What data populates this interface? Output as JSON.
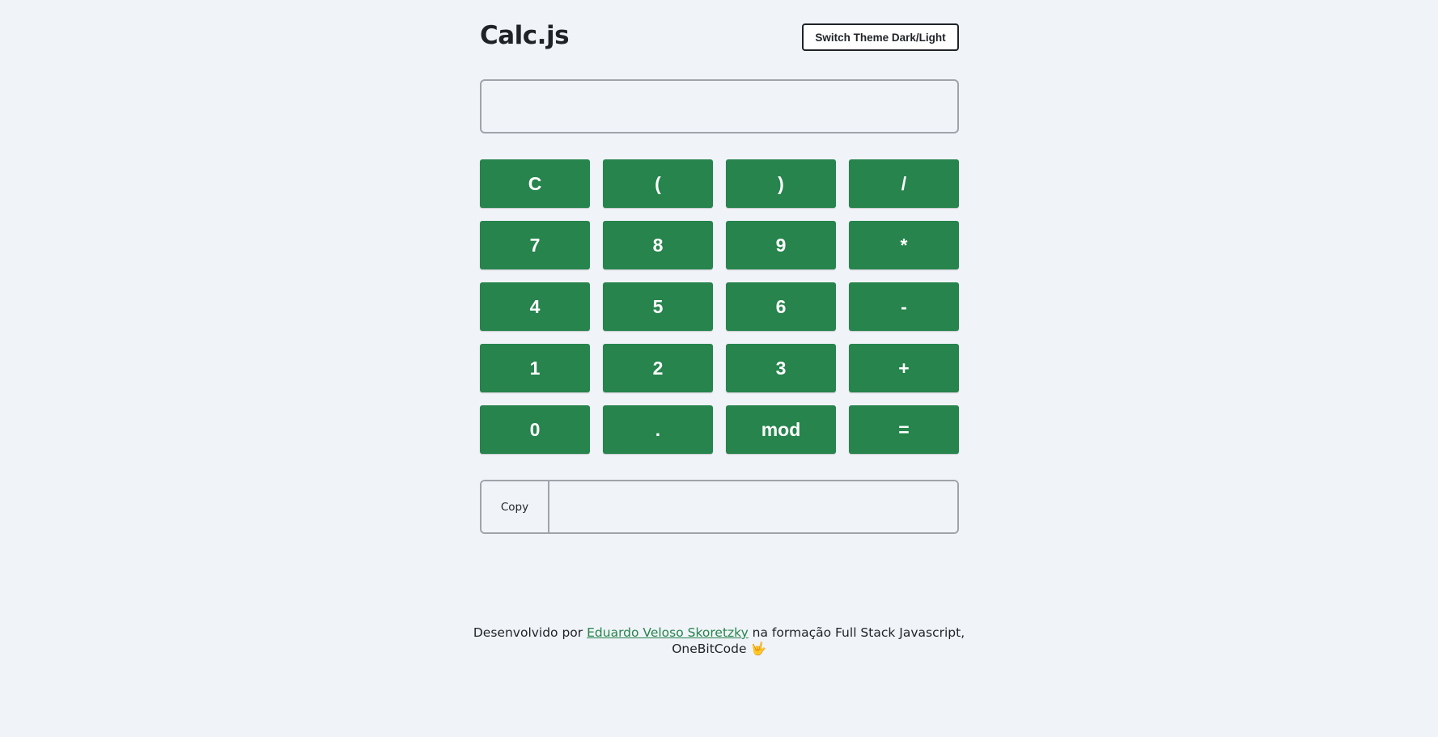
{
  "header": {
    "title": "Calc.js",
    "theme_button_label": "Switch Theme Dark/Light"
  },
  "display": {
    "value": "",
    "placeholder": ""
  },
  "keypad": {
    "keys": [
      "C",
      "(",
      ")",
      "/",
      "7",
      "8",
      "9",
      "*",
      "4",
      "5",
      "6",
      "-",
      "1",
      "2",
      "3",
      "+",
      "0",
      ".",
      "mod",
      "="
    ]
  },
  "copy_row": {
    "copy_label": "Copy",
    "result_value": ""
  },
  "footer": {
    "prefix": "Desenvolvido por ",
    "author_link": "Eduardo Veloso Skoretzky",
    "suffix": " na formação Full Stack Javascript,",
    "line2": "OneBitCode",
    "emoji": "🤟"
  },
  "colors": {
    "background": "#f0f3f8",
    "key_green": "#26844c",
    "text": "#1f2328",
    "border": "#a0a4aa"
  }
}
